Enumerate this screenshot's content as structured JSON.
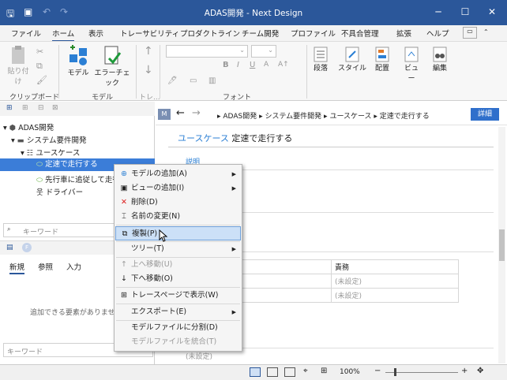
{
  "window": {
    "title": "ADAS開発 - Next Design"
  },
  "tabs": [
    "ファイル",
    "ホーム",
    "表示",
    "トレーサビリティ",
    "プロダクトライン",
    "チーム開発",
    "プロファイル",
    "不具合管理",
    "拡張",
    "ヘルプ"
  ],
  "ribbon": {
    "paste": "貼り付け",
    "clipboard": "クリップボード",
    "model_btn": "モデル",
    "error_btn": "エラーチェック",
    "model_group": "モデル",
    "trace_group": "トレ...",
    "font_group": "フォント",
    "para": "段落",
    "style": "スタイル",
    "layout": "配置",
    "view": "ビュー",
    "edit": "編集"
  },
  "tree": {
    "root": "ADAS開発",
    "level1": "システム要件開発",
    "level2": "ユースケース",
    "selected": "定速で走行する",
    "item2": "先行車に追従して走行",
    "item3": "ドライバー"
  },
  "left": {
    "keyword": "キーワード",
    "tabs": [
      "新規",
      "参照",
      "入力"
    ],
    "empty": "追加できる要素がありません",
    "keyword2": "キーワード"
  },
  "right": {
    "badge": "M",
    "breadcrumb": [
      "ADAS開発",
      "システム要件開発",
      "ユースケース",
      "定速で走行する"
    ],
    "detail_btn": "詳細",
    "heading_type": "ユースケース",
    "heading_name": "定速で走行する",
    "section": "説明",
    "col_resp": "責務",
    "unset1": "(未設定)",
    "unset2": "(未設定)",
    "unset3": "(未設定)"
  },
  "menu": [
    {
      "label": "モデルの追加(A)",
      "sub": true
    },
    {
      "label": "ビューの追加(I)",
      "sub": true
    },
    {
      "label": "削除(D)"
    },
    {
      "label": "名前の変更(N)"
    },
    {
      "label": "複製(P)"
    },
    {
      "label": "ツリー(T)",
      "sub": true
    },
    {
      "label": "上へ移動(U)"
    },
    {
      "label": "下へ移動(O)"
    },
    {
      "label": "トレースページで表示(W)"
    },
    {
      "label": "エクスポート(E)",
      "sub": true
    },
    {
      "label": "モデルファイルに分割(D)"
    },
    {
      "label": "モデルファイルを統合(T)"
    }
  ],
  "status": {
    "zoom": "100%"
  }
}
